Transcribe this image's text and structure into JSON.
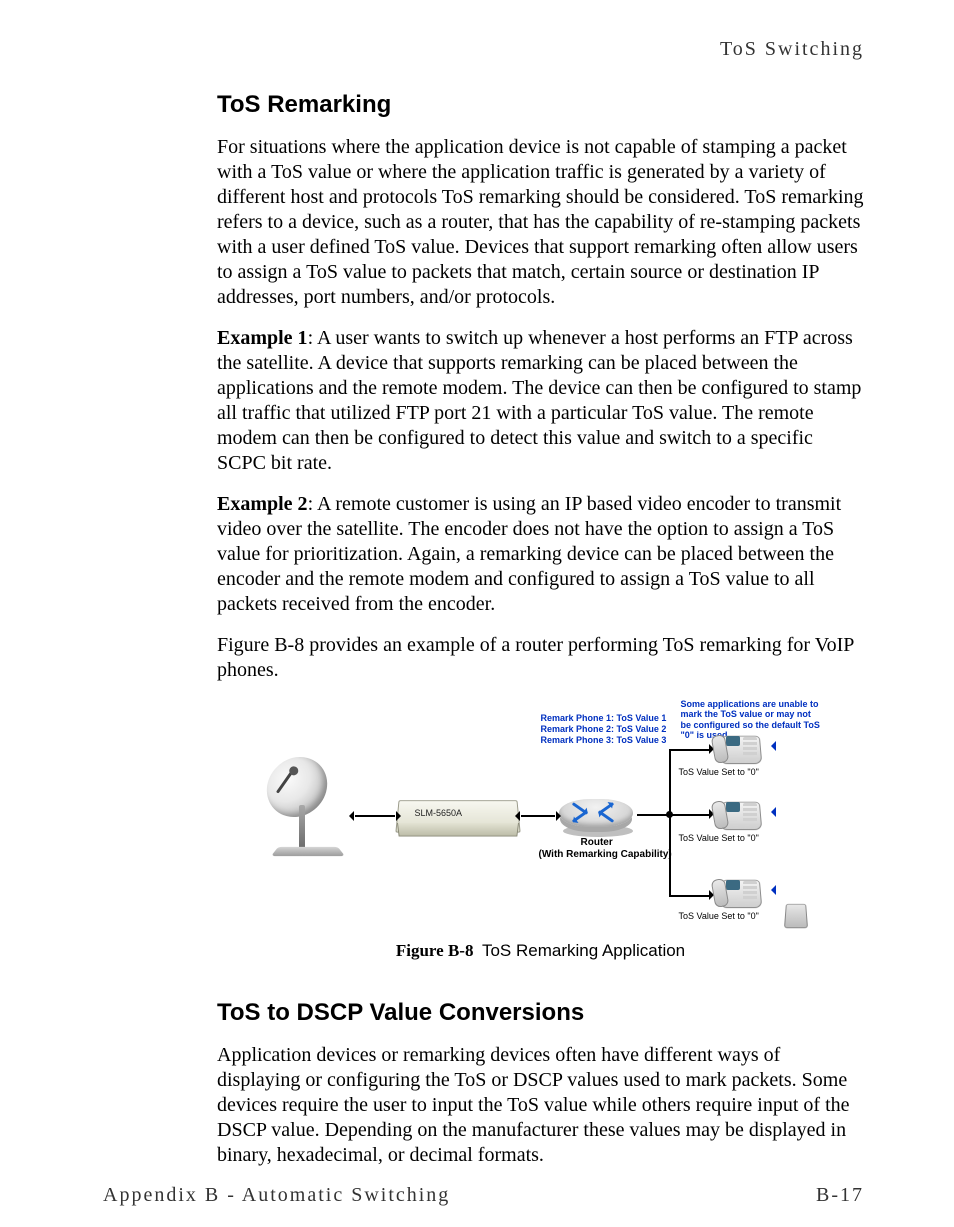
{
  "header": {
    "running": "ToS Switching"
  },
  "section1": {
    "title": "ToS Remarking",
    "p1": "For situations where the application device is not capable of stamping a packet with a ToS value or where the application traffic is generated by a variety of different host and protocols ToS remarking should be considered. ToS remarking refers to a device, such as a router, that has the capability of re-stamping packets with a user defined ToS value. Devices that support remarking often allow users to assign a ToS value to packets that match, certain source or destination IP addresses, port numbers, and/or protocols.",
    "ex1_label": "Example 1",
    "ex1_text": ": A user wants to switch up whenever a host performs an FTP across the satellite. A device that supports remarking can be placed between the applications and the remote modem. The device can then be configured to stamp all traffic that utilized FTP port 21 with a particular ToS value. The remote modem can then be configured to detect this value and switch to a specific SCPC bit rate.",
    "ex2_label": "Example 2",
    "ex2_text": ": A remote customer is using an IP based video encoder to transmit video over the satellite. The encoder does not have the option to assign a ToS value for prioritization. Again, a remarking device can be placed between the encoder and the remote modem and configured to assign a ToS value to all packets received from the encoder.",
    "p4": "Figure B-8 provides an example of a router performing ToS remarking for VoIP phones."
  },
  "figure": {
    "label": "Figure B-8",
    "caption": "ToS Remarking Application",
    "note_top": "Some applications are unable to mark the ToS value or may not be configured so the default ToS \"0\" is used",
    "remark1": "Remark Phone 1: ToS Value 1",
    "remark2": "Remark Phone 2: ToS Value 2",
    "remark3": "Remark Phone 3: ToS Value 3",
    "modem_model": "SLM-5650A",
    "router_label": "Router",
    "router_sub": "(With Remarking Capability)",
    "tos0_1": "ToS Value Set to \"0\"",
    "tos0_2": "ToS Value Set to \"0\"",
    "tos0_3": "ToS Value Set to \"0\""
  },
  "section2": {
    "title": "ToS to DSCP Value Conversions",
    "p1": "Application devices or remarking devices often have different ways of displaying or configuring the ToS or DSCP values used to mark packets. Some devices require the user to input the ToS value while others require input of the DSCP value. Depending on the manufacturer these values may be displayed in binary, hexadecimal, or decimal formats."
  },
  "footer": {
    "left": "Appendix B - Automatic Switching",
    "right": "B-17"
  }
}
